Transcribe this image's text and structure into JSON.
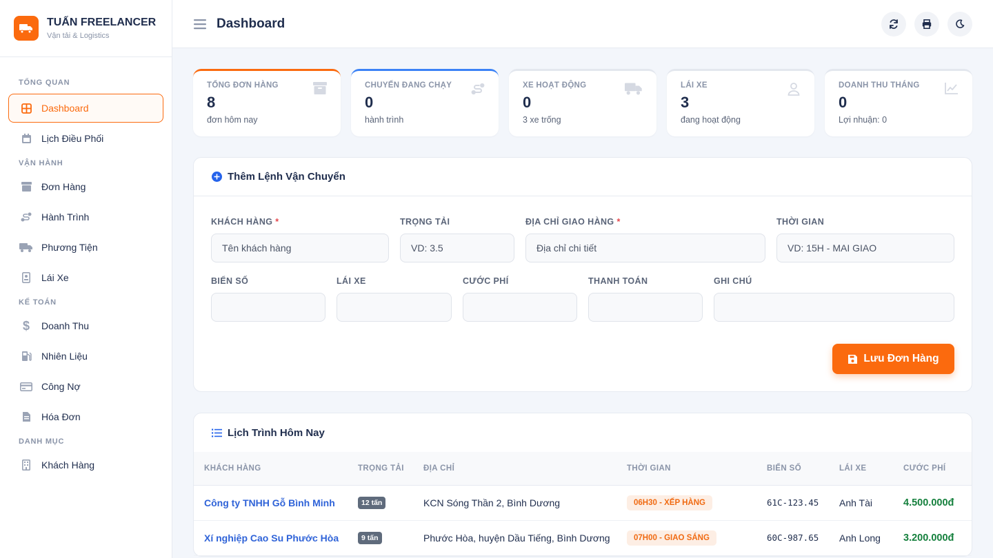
{
  "brand": {
    "name": "TUẤN FREELANCER",
    "subtitle": "Vận tải & Logistics"
  },
  "sidebar": {
    "sections": [
      {
        "title": "TỔNG QUAN",
        "items": [
          {
            "label": "Dashboard",
            "icon": "grid-icon",
            "active": true
          },
          {
            "label": "Lịch Điều Phối",
            "icon": "calendar-icon"
          }
        ]
      },
      {
        "title": "VẬN HÀNH",
        "items": [
          {
            "label": "Đơn Hàng",
            "icon": "box-icon"
          },
          {
            "label": "Hành Trình",
            "icon": "route-icon"
          },
          {
            "label": "Phương Tiện",
            "icon": "truck-icon"
          },
          {
            "label": "Lái Xe",
            "icon": "id-badge-icon"
          }
        ]
      },
      {
        "title": "KẾ TOÁN",
        "items": [
          {
            "label": "Doanh Thu",
            "icon": "dollar-icon"
          },
          {
            "label": "Nhiên Liệu",
            "icon": "fuel-icon"
          },
          {
            "label": "Công Nợ",
            "icon": "credit-card-icon"
          },
          {
            "label": "Hóa Đơn",
            "icon": "invoice-icon"
          }
        ]
      },
      {
        "title": "DANH MỤC",
        "items": [
          {
            "label": "Khách Hàng",
            "icon": "building-icon"
          }
        ]
      }
    ]
  },
  "header": {
    "title": "Dashboard",
    "actions": [
      "refresh-icon",
      "print-icon",
      "moon-icon"
    ]
  },
  "stats": [
    {
      "label": "TỔNG ĐƠN HÀNG",
      "value": "8",
      "sub": "đơn hôm nay",
      "icon": "box-icon",
      "accent": "#fb6a0e"
    },
    {
      "label": "CHUYẾN ĐANG CHẠY",
      "value": "0",
      "sub": "hành trình",
      "icon": "route-icon",
      "accent": "#3b82f6"
    },
    {
      "label": "XE HOẠT ĐỘNG",
      "value": "0",
      "sub": "3 xe trống",
      "icon": "truck-icon",
      "accent": "#e3e7ee"
    },
    {
      "label": "LÁI XE",
      "value": "3",
      "sub": "đang hoạt động",
      "icon": "user-icon",
      "accent": "#e3e7ee"
    },
    {
      "label": "DOANH THU THÁNG",
      "value": "0",
      "sub": "Lợi nhuận: 0",
      "icon": "chart-line-icon",
      "accent": "#e3e7ee"
    }
  ],
  "order_form": {
    "title": "Thêm Lệnh Vận Chuyển",
    "fields": {
      "customer": {
        "label": "KHÁCH HÀNG",
        "required": "*",
        "placeholder": "Tên khách hàng"
      },
      "load": {
        "label": "TRỌNG TẢI",
        "placeholder": "VD: 3.5"
      },
      "address": {
        "label": "ĐỊA CHỈ GIAO HÀNG",
        "required": "*",
        "placeholder": "Địa chỉ chi tiết"
      },
      "time": {
        "label": "THỜI GIAN",
        "placeholder": "VD: 15H - MAI GIAO"
      },
      "plate": {
        "label": "BIỂN SỐ",
        "placeholder": ""
      },
      "driver": {
        "label": "LÁI XE",
        "placeholder": ""
      },
      "fee": {
        "label": "CƯỚC PHÍ",
        "placeholder": ""
      },
      "payment": {
        "label": "THANH TOÁN",
        "placeholder": ""
      },
      "note": {
        "label": "GHI CHÚ",
        "placeholder": ""
      }
    },
    "save_label": "Lưu Đơn Hàng"
  },
  "schedule": {
    "title": "Lịch Trình Hôm Nay",
    "columns": [
      "KHÁCH HÀNG",
      "TRỌNG TẢI",
      "ĐỊA CHỈ",
      "THỜI GIAN",
      "BIỂN SỐ",
      "LÁI XE",
      "CƯỚC PHÍ"
    ],
    "rows": [
      {
        "customer": "Công ty TNHH Gỗ Bình Minh",
        "load": "12 tấn",
        "address": "KCN Sóng Thần 2, Bình Dương",
        "time": "06H30 - XẾP HÀNG",
        "plate": "61C-123.45",
        "driver": "Anh Tài",
        "fee": "4.500.000đ"
      },
      {
        "customer": "Xí nghiệp Cao Su Phước Hòa",
        "load": "9 tấn",
        "address": "Phước Hòa, huyện Dầu Tiếng, Bình Dương",
        "time": "07H00 - GIAO SÁNG",
        "plate": "60C-987.65",
        "driver": "Anh Long",
        "fee": "3.200.000đ"
      }
    ]
  },
  "colors": {
    "accent": "#fb6a0e",
    "link": "#2f63d8",
    "money": "#15803d"
  }
}
